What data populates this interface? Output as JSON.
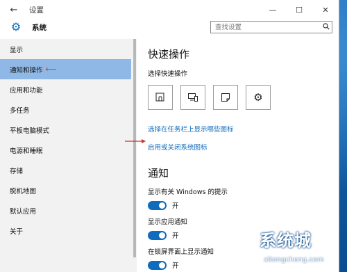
{
  "window": {
    "title": "设置",
    "controls": {
      "minimize": "—",
      "maximize": "☐",
      "close": "✕"
    }
  },
  "header": {
    "title": "系统",
    "search": {
      "placeholder": "查找设置",
      "value": ""
    }
  },
  "sidebar": {
    "items": [
      {
        "label": "显示",
        "active": false
      },
      {
        "label": "通知和操作",
        "active": true
      },
      {
        "label": "应用和功能",
        "active": false
      },
      {
        "label": "多任务",
        "active": false
      },
      {
        "label": "平板电脑模式",
        "active": false
      },
      {
        "label": "电源和睡眠",
        "active": false
      },
      {
        "label": "存储",
        "active": false
      },
      {
        "label": "脱机地图",
        "active": false
      },
      {
        "label": "默认应用",
        "active": false
      },
      {
        "label": "关于",
        "active": false
      }
    ]
  },
  "main": {
    "quick_actions_title": "快速操作",
    "quick_actions_subtitle": "选择快速操作",
    "quick_tiles": [
      "tablet-mode-icon",
      "connect-icon",
      "note-icon",
      "settings-icon"
    ],
    "link_taskbar_icons": "选择在任务栏上显示哪些图标",
    "link_system_icons": "启用或关闭系统图标",
    "notifications_title": "通知",
    "settings": [
      {
        "label": "显示有关 Windows 的提示",
        "state": "开"
      },
      {
        "label": "显示应用通知",
        "state": "开"
      },
      {
        "label": "在锁屏界面上显示通知",
        "state": "开"
      }
    ]
  },
  "watermark": {
    "brand": "系统城",
    "url": "xitongcheng.com"
  },
  "colors": {
    "accent": "#0f6cbd",
    "sidebar_active": "#8fb8e6",
    "annotation": "#c0392b"
  }
}
